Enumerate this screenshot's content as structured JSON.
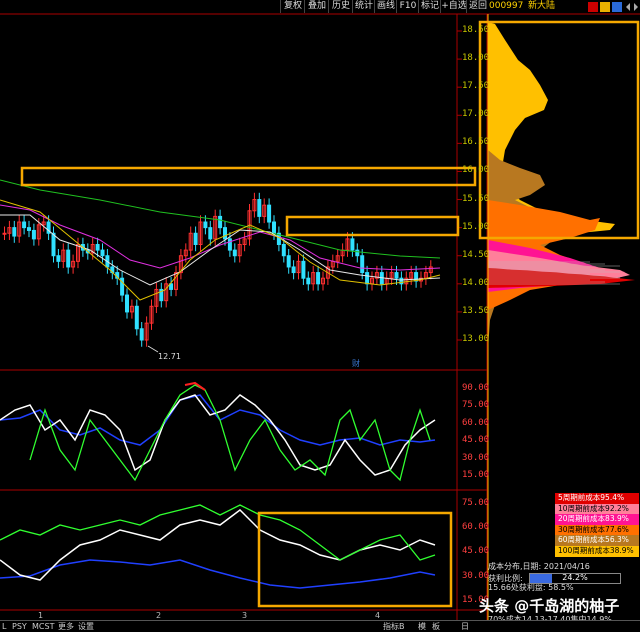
{
  "toolbar": {
    "buttons": [
      "复权",
      "叠加",
      "历史",
      "统计",
      "画线",
      "F10",
      "标记",
      "+自选",
      "返回"
    ],
    "stock_code": "000997",
    "stock_name": "新大陆"
  },
  "price_axis": {
    "labels": [
      "18.50",
      "18.00",
      "17.50",
      "17.00",
      "16.50",
      "16.00",
      "15.50",
      "15.00",
      "14.50",
      "14.00",
      "13.50",
      "13.00"
    ],
    "values": [
      18.5,
      18.0,
      17.5,
      17.0,
      16.5,
      16.0,
      15.5,
      15.0,
      14.5,
      14.0,
      13.5,
      13.0
    ],
    "low_label": "12.71",
    "marker_char": "财"
  },
  "indicator1_axis": {
    "labels": [
      "90.00",
      "75.00",
      "60.00",
      "45.00",
      "30.00",
      "15.00"
    ]
  },
  "indicator2_axis": {
    "labels": [
      "75.00",
      "60.00",
      "45.00",
      "30.00",
      "15.00"
    ]
  },
  "x_ticks": [
    "1",
    "2",
    "3",
    "4"
  ],
  "legend": [
    {
      "label": "5周期前成本95.4%",
      "color": "#e00000"
    },
    {
      "label": "10周期前成本92.2%",
      "color": "#ff7f9a"
    },
    {
      "label": "20周期前成本83.9%",
      "color": "#ff1493"
    },
    {
      "label": "30周期前成本77.6%",
      "color": "#ff7000"
    },
    {
      "label": "60周期前成本56.3%",
      "color": "#b87820"
    },
    {
      "label": "100周期前成本38.9%",
      "color": "#ffc000"
    }
  ],
  "info": {
    "line1": "成本分布,日期:  2021/04/16",
    "line2_label": "获利比例:",
    "line2_value": "24.2%",
    "line3": "15.66处获利盘:  58.5%",
    "line5": "70%成本14.13-17.40集中14.9%"
  },
  "bottom_bar": {
    "left_items": [
      "L",
      "PSY",
      "MCST",
      "更多",
      "设置"
    ],
    "right_items": [
      "指标B",
      "模",
      "板",
      "日"
    ]
  },
  "watermark": "头条 @千岛湖的柚子"
}
